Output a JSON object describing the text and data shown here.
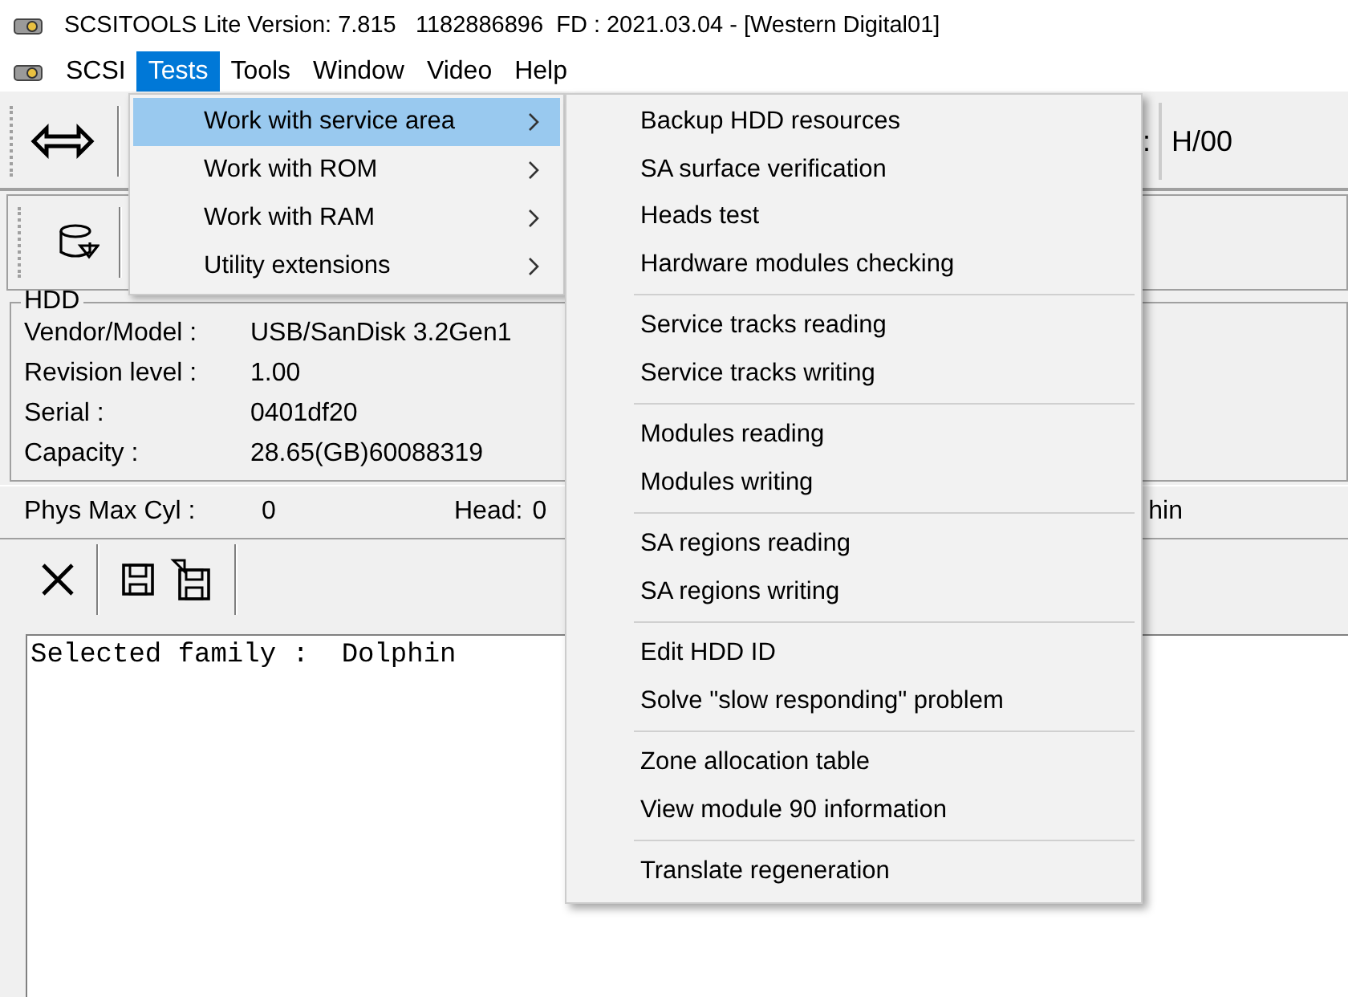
{
  "window": {
    "title": "SCSITOOLS Lite Version: 7.815   1182886896  FD : 2021.03.04 - [Western Digital01]"
  },
  "menu_bar": [
    {
      "label": "SCSI",
      "selected": false
    },
    {
      "label": "Tests",
      "selected": true
    },
    {
      "label": "Tools",
      "selected": false
    },
    {
      "label": "Window",
      "selected": false
    },
    {
      "label": "Video",
      "selected": false
    },
    {
      "label": "Help",
      "selected": false
    }
  ],
  "toolbar": {
    "field_label": ":",
    "field_value": "H/00"
  },
  "hdd": {
    "title": "HDD",
    "rows": [
      {
        "label": "Vendor/Model :",
        "value": "USB/SanDisk 3.2Gen1"
      },
      {
        "label": "Revision level :",
        "value": "1.00"
      },
      {
        "label": "Serial :",
        "value": "0401df20"
      },
      {
        "label": "Capacity :",
        "value": "28.65(GB)60088319"
      }
    ]
  },
  "geometry": {
    "phys_max_cyl_label": "Phys Max Cyl :",
    "phys_max_cyl_value": "0",
    "head_label": "Head:",
    "head_value": "0",
    "column_3": "hin"
  },
  "log": {
    "lines": [
      "Selected family :  Dolphin"
    ]
  },
  "tests_menu": [
    {
      "label": "Work with service area",
      "selected": true,
      "has_submenu": true
    },
    {
      "label": "Work with ROM",
      "selected": false,
      "has_submenu": true
    },
    {
      "label": "Work with RAM",
      "selected": false,
      "has_submenu": true
    },
    {
      "label": "Utility extensions",
      "selected": false,
      "has_submenu": true
    }
  ],
  "service_area_menu": [
    [
      "Backup HDD resources",
      "SA surface verification",
      "Heads test",
      "Hardware modules checking"
    ],
    [
      "Service tracks reading",
      "Service tracks writing"
    ],
    [
      "Modules reading",
      "Modules writing"
    ],
    [
      "SA regions reading",
      "SA regions writing"
    ],
    [
      "Edit HDD ID",
      "Solve \"slow responding\" problem"
    ],
    [
      "Zone allocation table",
      "View module 90 information"
    ],
    [
      "Translate regeneration"
    ]
  ]
}
